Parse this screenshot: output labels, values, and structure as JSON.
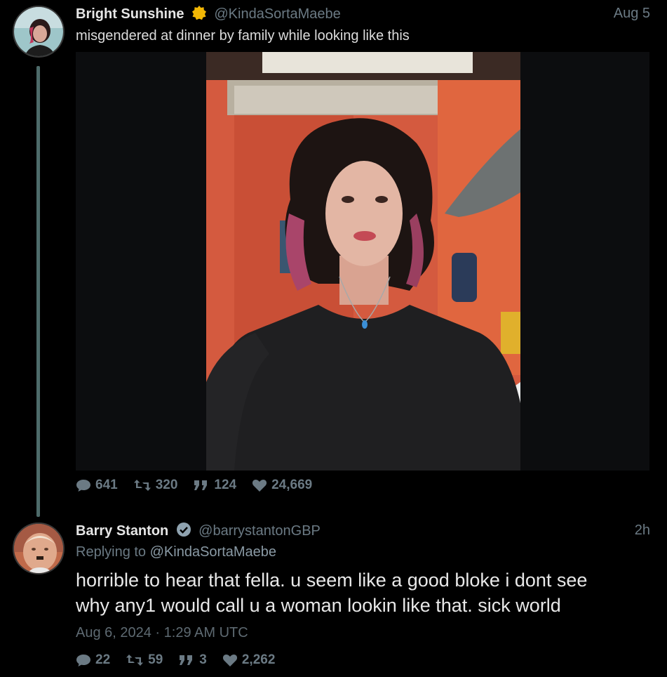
{
  "tweet1": {
    "display_name": "Bright Sunshine",
    "handle": "@KindaSortaMaebe",
    "time": "Aug 5",
    "text": "misgendered at dinner by family while looking like this",
    "stats": {
      "replies": "641",
      "retweets": "320",
      "quotes": "124",
      "likes": "24,669"
    }
  },
  "tweet2": {
    "display_name": "Barry Stanton",
    "handle": "@barrystantonGBP",
    "time": "2h",
    "replying_prefix": "Replying to",
    "replying_to": "@KindaSortaMaebe",
    "text_line1": "horrible to hear that fella. u seem like a good bloke i dont see",
    "text_line2": "why any1 would call u a woman lookin like that. sick world",
    "date": "Aug 6, 2024 · 1:29 AM UTC",
    "stats": {
      "replies": "22",
      "retweets": "59",
      "quotes": "3",
      "likes": "2,262"
    }
  },
  "colors": {
    "background": "#000000",
    "thread_line": "#4d6b6a",
    "muted": "#6b7a84",
    "gold_badge": "#f2b705",
    "blue_badge": "#8fa3b0"
  },
  "icons": [
    "reply-icon",
    "retweet-icon",
    "quote-icon",
    "heart-icon",
    "gold-verified-icon",
    "verified-icon"
  ]
}
